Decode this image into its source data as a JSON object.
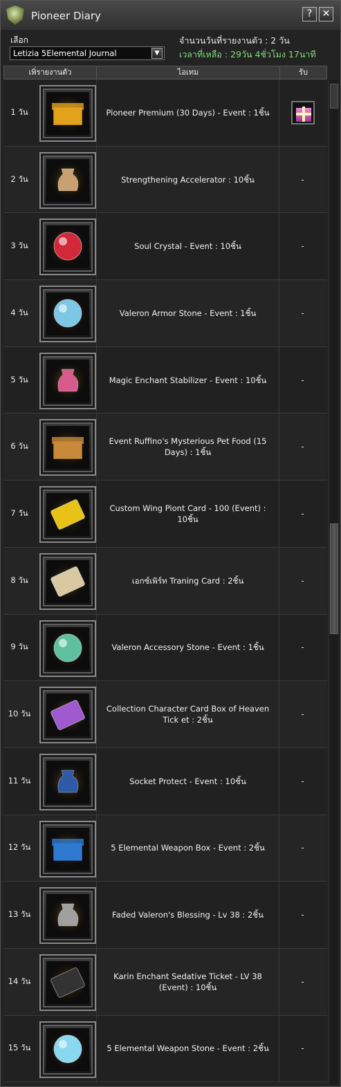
{
  "window": {
    "title": "Pioneer Diary",
    "help_label": "?",
    "close_label": "✕"
  },
  "selector": {
    "label": "เลือก",
    "value": "Letizia 5Elemental Journal"
  },
  "info": {
    "days_reported": "จำนวนวันที่รายงานตัว : 2 วัน",
    "time_left": "เวลาที่เหลือ : 29วัน 4ชั่วโมง 17นาที"
  },
  "table": {
    "headers": {
      "day": "เพิ่รายงานตัว",
      "item": "ไอเทม",
      "receive": "รับ"
    },
    "rows": [
      {
        "day": "1 วัน",
        "item": "Pioneer Premium (30 Days) - Event : 1ชิ้น",
        "receive": "",
        "icon": "treasure-box-icon",
        "color": "#e2a21c"
      },
      {
        "day": "2 วัน",
        "item": "Strengthening Accelerator : 10ชิ้น",
        "receive": "-",
        "icon": "powder-bag-icon",
        "color": "#c9a070"
      },
      {
        "day": "3 วัน",
        "item": "Soul Crystal - Event : 10ชิ้น",
        "receive": "-",
        "icon": "red-orb-icon",
        "color": "#d2283a"
      },
      {
        "day": "4 วัน",
        "item": "Valeron Armor Stone - Event : 1ชิ้น",
        "receive": "-",
        "icon": "armor-orb-icon",
        "color": "#7cc6e6"
      },
      {
        "day": "5 วัน",
        "item": "Magic Enchant Stabilizer - Event : 10ชิ้น",
        "receive": "-",
        "icon": "rainbow-pouch-icon",
        "color": "#d65a8a"
      },
      {
        "day": "6 วัน",
        "item": "Event Ruffino's Mysterious Pet Food (15 Days) : 1ชิ้น",
        "receive": "-",
        "icon": "chest-icon",
        "color": "#c8893a"
      },
      {
        "day": "7 วัน",
        "item": "Custom Wing Piont Card - 100 (Event) : 10ชิ้น",
        "receive": "-",
        "icon": "gold-card-icon",
        "color": "#e9c218"
      },
      {
        "day": "8 วัน",
        "item": "เอกซ์เพิร์ท Traning Card : 2ชิ้น",
        "receive": "-",
        "icon": "paper-card-icon",
        "color": "#d9c9a3"
      },
      {
        "day": "9 วัน",
        "item": "Valeron Accessory Stone - Event : 1ชิ้น",
        "receive": "-",
        "icon": "green-orb-icon",
        "color": "#5fc0a0"
      },
      {
        "day": "10 วัน",
        "item": "Collection Character Card Box of Heaven Tick et : 2ชิ้น",
        "receive": "-",
        "icon": "rainbow-ticket-icon",
        "color": "#a05ad0"
      },
      {
        "day": "11 วัน",
        "item": "Socket Protect - Event : 10ชิ้น",
        "receive": "-",
        "icon": "blue-pouch-icon",
        "color": "#2e5aa8"
      },
      {
        "day": "12 วัน",
        "item": "5 Elemental Weapon Box - Event : 2ชิ้น",
        "receive": "-",
        "icon": "blue-box-icon",
        "color": "#2f7ad0"
      },
      {
        "day": "13 วัน",
        "item": "Faded Valeron's Blessing - Lv 38 : 2ชิ้น",
        "receive": "-",
        "icon": "grey-sack-icon",
        "color": "#a0a0a0"
      },
      {
        "day": "14 วัน",
        "item": "Karin Enchant Sedative Ticket - LV 38 (Event) : 10ชิ้น",
        "receive": "-",
        "icon": "black-ticket-icon",
        "color": "#333333"
      },
      {
        "day": "15 วัน",
        "item": "5 Elemental Weapon Stone - Event : 2ชิ้น",
        "receive": "-",
        "icon": "elemental-orb-icon",
        "color": "#88d8f0"
      }
    ]
  }
}
